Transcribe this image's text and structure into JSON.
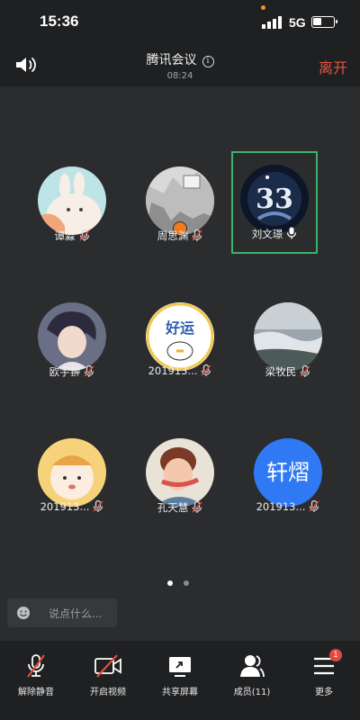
{
  "status_bar": {
    "time": "15:36",
    "network": "5G"
  },
  "meeting": {
    "title": "腾讯会议",
    "duration": "08:24",
    "leave_label": "离开"
  },
  "participants": [
    {
      "name": "谭淼",
      "muted": true
    },
    {
      "name": "周思渊",
      "muted": true,
      "host": true
    },
    {
      "name": "刘文璟",
      "muted": false,
      "active": true
    },
    {
      "name": "欧宇翀",
      "muted": true
    },
    {
      "name": "201913...",
      "muted": true
    },
    {
      "name": "梁牧民",
      "muted": true
    },
    {
      "name": "201913...",
      "muted": true
    },
    {
      "name": "孔天慧",
      "muted": true
    },
    {
      "name": "201913...",
      "muted": true,
      "avatar_text": "轩熠"
    }
  ],
  "chat": {
    "placeholder": "说点什么..."
  },
  "toolbar": {
    "unmute": "解除静音",
    "start_video": "开启视频",
    "share_screen": "共享屏幕",
    "members": "成员(11)",
    "more": "更多",
    "more_badge": "1"
  },
  "colors": {
    "background": "#2b2c2e",
    "bar": "#1f2022",
    "leave": "#e5533f",
    "active_border": "#3ab46a",
    "muted_red": "#e54b3c",
    "avatar_blue": "#2f79f4"
  }
}
